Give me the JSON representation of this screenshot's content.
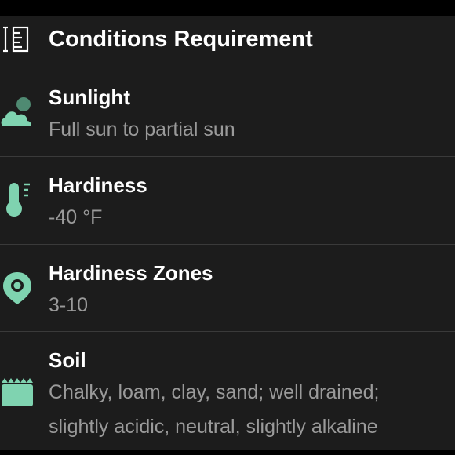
{
  "section": {
    "title": "Conditions Requirement",
    "title_icon": "ruler-icon"
  },
  "accent_color": "#7fd3b0",
  "conditions": [
    {
      "label": "Sunlight",
      "value": "Full sun to partial sun",
      "icon": "partly-cloudy-icon"
    },
    {
      "label": "Hardiness",
      "value": "-40 °F",
      "icon": "thermometer-icon"
    },
    {
      "label": "Hardiness Zones",
      "value": "3-10",
      "icon": "location-pin-icon"
    },
    {
      "label": "Soil",
      "value": "Chalky, loam, clay, sand; well drained; slightly acidic, neutral, slightly alkaline",
      "icon": "soil-bed-icon"
    }
  ]
}
